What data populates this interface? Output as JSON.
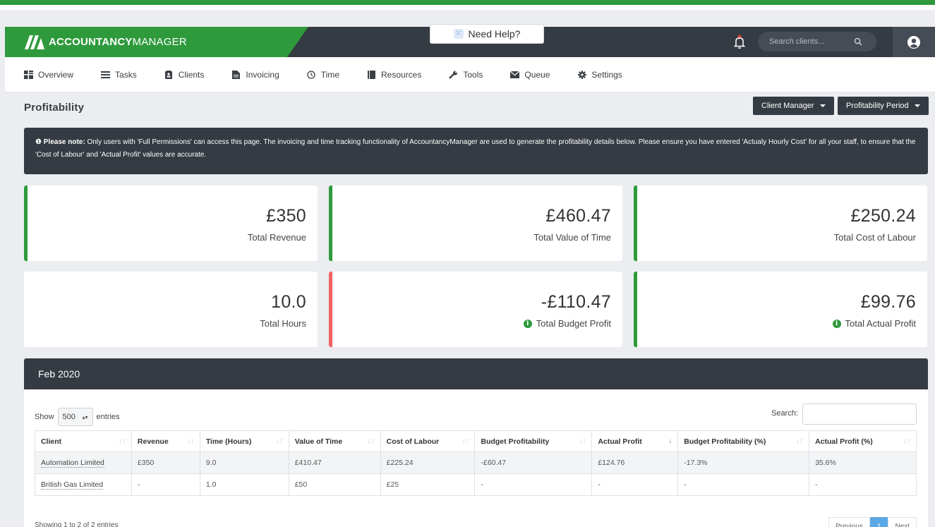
{
  "header": {
    "brand_bold": "ACCOUNTANCY",
    "brand_light": "MANAGER",
    "help_label": "Need Help?",
    "search_placeholder": "Search clients..."
  },
  "nav": [
    {
      "label": "Overview",
      "icon": "grid-icon"
    },
    {
      "label": "Tasks",
      "icon": "list-icon"
    },
    {
      "label": "Clients",
      "icon": "contacts-icon"
    },
    {
      "label": "Invoicing",
      "icon": "file-icon"
    },
    {
      "label": "Time",
      "icon": "clock-icon"
    },
    {
      "label": "Resources",
      "icon": "book-icon"
    },
    {
      "label": "Tools",
      "icon": "wrench-icon"
    },
    {
      "label": "Queue",
      "icon": "envelope-icon"
    },
    {
      "label": "Settings",
      "icon": "gear-icon"
    }
  ],
  "page": {
    "title": "Profitability",
    "client_manager_label": "Client Manager",
    "period_label": "Profitability Period"
  },
  "notice": {
    "bold": "Please note:",
    "text": " Only users with 'Full Permissions' can access this page. The invoicing and time tracking functionality of AccountancyManager are used to generate the profitability details below. Please ensure you have entered 'Actualy Hourly Cost' for all your staff, to ensure that the 'Cost of Labour' and 'Actual Profit' values are accurate."
  },
  "cards": [
    {
      "value": "£350",
      "label": "Total Revenue",
      "status": "green"
    },
    {
      "value": "£460.47",
      "label": "Total Value of Time",
      "status": "green"
    },
    {
      "value": "£250.24",
      "label": "Total Cost of Labour",
      "status": "green"
    },
    {
      "value": "10.0",
      "label": "Total Hours",
      "status": "none"
    },
    {
      "value": "-£110.47",
      "label": "Total Budget Profit",
      "status": "red",
      "info": true
    },
    {
      "value": "£99.76",
      "label": "Total Actual Profit",
      "status": "green",
      "info": true
    }
  ],
  "table": {
    "period": "Feb 2020",
    "show_label": "Show",
    "entries_value": "500",
    "entries_label": "entries",
    "search_label": "Search:",
    "columns": [
      "Client",
      "Revenue",
      "Time (Hours)",
      "Value of Time",
      "Cost of Labour",
      "Budget Profitability",
      "Actual Profit",
      "Budget Profitability (%)",
      "Actual Profit (%)"
    ],
    "sorted_column": "Actual Profit",
    "rows": [
      [
        "Automation Limited",
        "£350",
        "9.0",
        "£410.47",
        "£225.24",
        "-£60.47",
        "£124.76",
        "-17.3%",
        "35.6%"
      ],
      [
        "British Gas Limited",
        "-",
        "1.0",
        "£50",
        "£25",
        "-",
        "-",
        "-",
        "-"
      ]
    ],
    "info": "Showing 1 to 2 of 2 entries",
    "pager": {
      "previous": "Previous",
      "current": "1",
      "next": "Next"
    }
  }
}
